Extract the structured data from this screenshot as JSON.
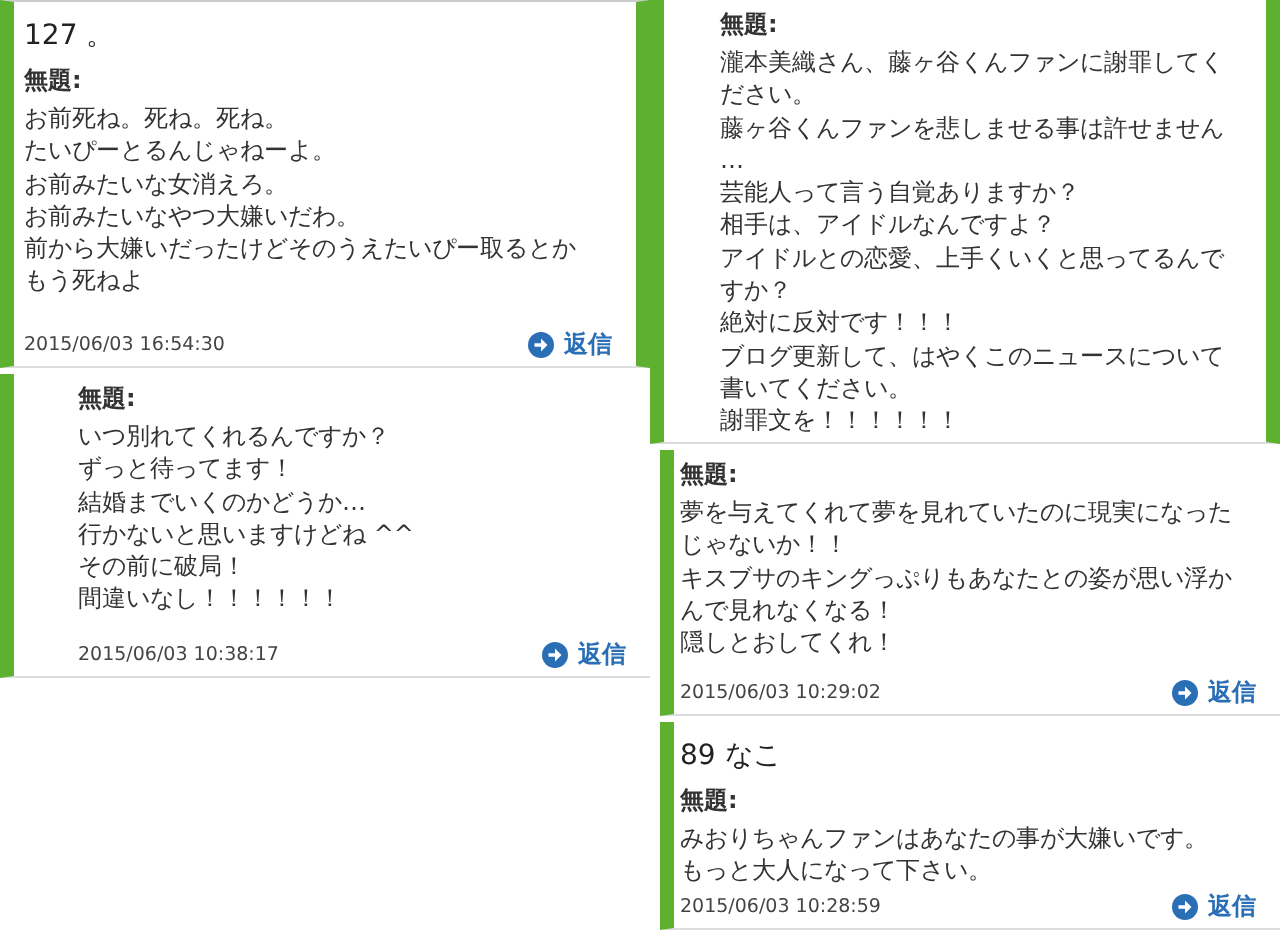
{
  "columns": [
    {
      "comments": [
        {
          "author": "127 。",
          "subject": "無題:",
          "lines": [
            "お前死ね。死ね。死ね。",
            "たいぴーとるんじゃねーよ。",
            "お前みたいな女消えろ。",
            "お前みたいなやつ大嫌いだわ。",
            "前から大嫌いだったけどそのうえたいぴー取るとか",
            "もう死ねよ"
          ],
          "timestamp": "2015/06/03 16:54:30",
          "reply": "返信"
        },
        {
          "subject": "無題:",
          "lines": [
            "いつ別れてくれるんですか？",
            "ずっと待ってます！",
            "結婚までいくのかどうか…",
            "行かないと思いますけどね ^^",
            "その前に破局！",
            "間違いなし！！！！！！"
          ],
          "timestamp": "2015/06/03 10:38:17",
          "reply": "返信"
        }
      ]
    },
    {
      "comments": [
        {
          "subject": "無題:",
          "lines": [
            "瀧本美織さん、藤ヶ谷くんファンに謝罪してく",
            "ださい。",
            "藤ヶ谷くんファンを悲しませる事は許せません",
            "…",
            "芸能人って言う自覚ありますか？",
            "相手は、アイドルなんですよ？",
            "アイドルとの恋愛、上手くいくと思ってるんで",
            "すか？",
            "絶対に反対です！！！",
            "ブログ更新して、はやくこのニュースについて",
            "書いてください。",
            "謝罪文を！！！！！！"
          ]
        },
        {
          "subject": "無題:",
          "lines": [
            "夢を与えてくれて夢を見れていたのに現実になった",
            "じゃないか！！",
            "キスブサのキングっぷりもあなたとの姿が思い浮か",
            "んで見れなくなる！",
            "隠しとおしてくれ！"
          ],
          "timestamp": "2015/06/03 10:29:02",
          "reply": "返信"
        },
        {
          "author": "89 なこ",
          "subject": "無題:",
          "lines": [
            "みおりちゃんファンはあなたの事が大嫌いです。",
            "もっと大人になって下さい。"
          ],
          "timestamp": "2015/06/03 10:28:59",
          "reply": "返信"
        }
      ]
    }
  ]
}
